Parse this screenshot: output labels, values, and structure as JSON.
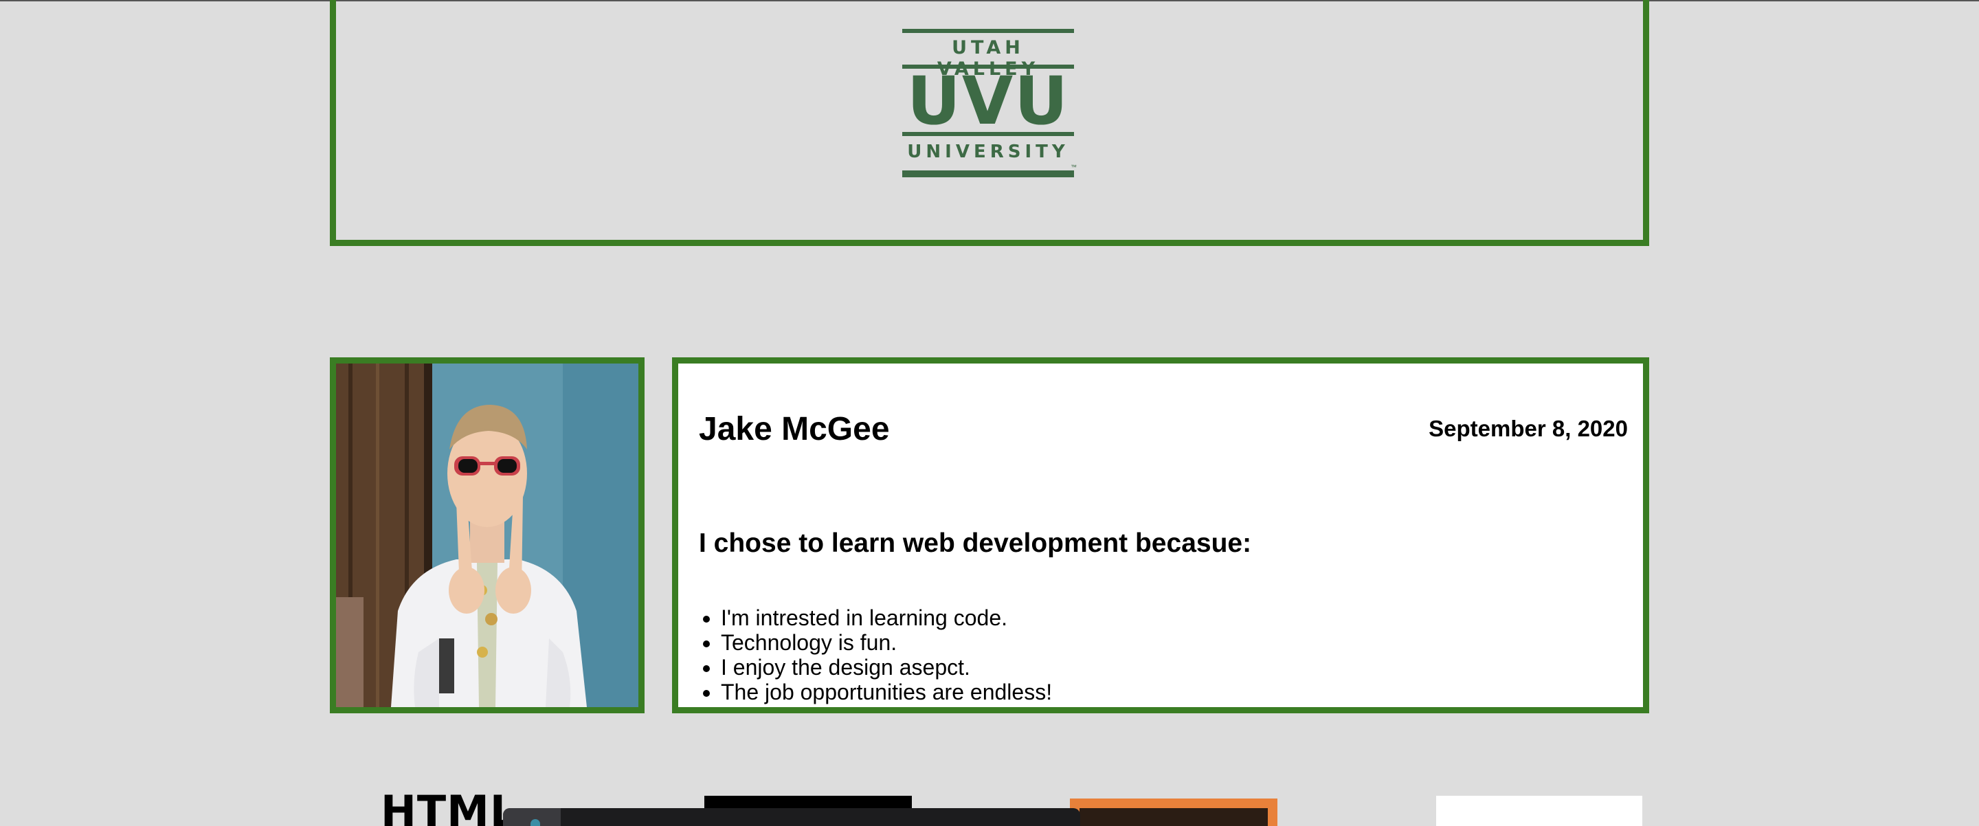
{
  "header": {
    "logo": {
      "top_text": "UTAH VALLEY",
      "big_text": "UVU",
      "bottom_text": "UNIVERSITY",
      "trademark": "™"
    },
    "border_color": "#3a7d23",
    "logo_color": "#3d6a45"
  },
  "profile": {
    "photo_icon": "profile-photo",
    "name": "Jake McGee",
    "date": "September 8, 2020",
    "reason_heading": "I chose to learn web development becasue:",
    "reasons": [
      "I'm intrested in learning code.",
      "Technology is fun.",
      "I enjoy the design asepct.",
      "The job opportunities are endless!"
    ]
  },
  "skills": {
    "html_label": "HTML"
  },
  "colors": {
    "page_background": "#dddddd",
    "accent_green": "#3a7d23",
    "card_background": "#ffffff",
    "orange": "#e8813a"
  }
}
